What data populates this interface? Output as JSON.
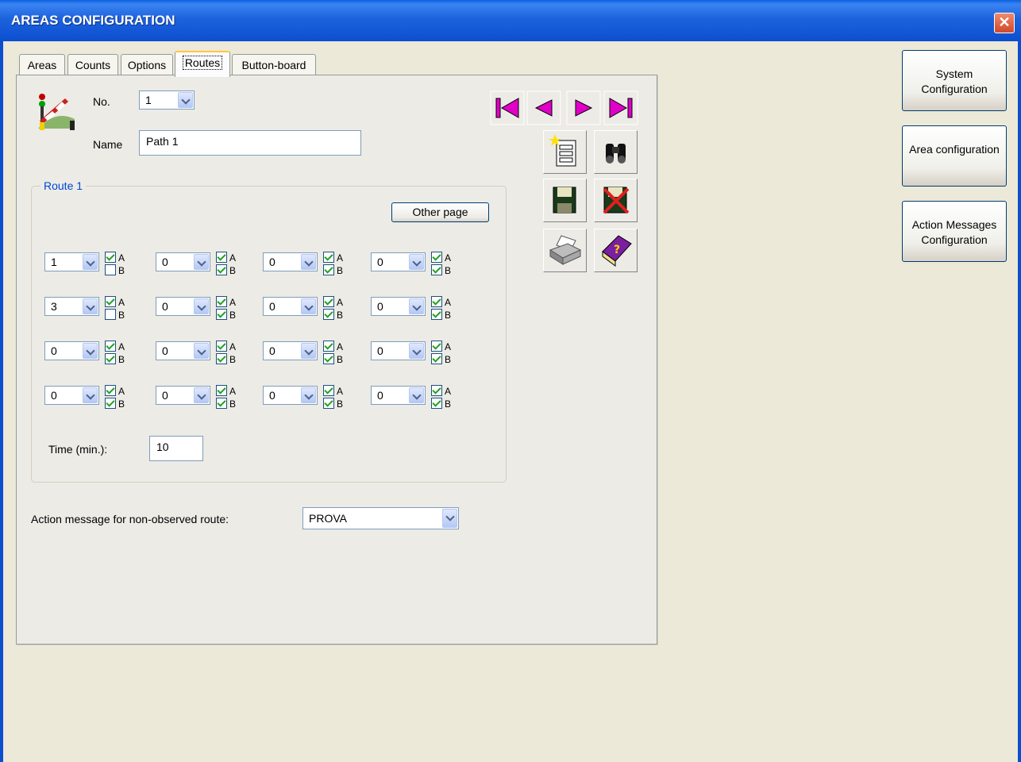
{
  "window": {
    "title": "AREAS CONFIGURATION",
    "close_glyph": "✕"
  },
  "tabs": [
    {
      "label": "Areas"
    },
    {
      "label": "Counts"
    },
    {
      "label": "Options"
    },
    {
      "label": "Routes",
      "active": true
    },
    {
      "label": "Button-board"
    }
  ],
  "header": {
    "no_label": "No.",
    "no_value": "1",
    "name_label": "Name",
    "name_value": "Path 1"
  },
  "route": {
    "title": "Route 1",
    "other_page_label": "Other page",
    "rows": [
      [
        {
          "v": "1",
          "a": true,
          "b": false
        },
        {
          "v": "0",
          "a": true,
          "b": true
        },
        {
          "v": "0",
          "a": true,
          "b": true
        },
        {
          "v": "0",
          "a": true,
          "b": true
        }
      ],
      [
        {
          "v": "3",
          "a": true,
          "b": false
        },
        {
          "v": "0",
          "a": true,
          "b": true
        },
        {
          "v": "0",
          "a": true,
          "b": true
        },
        {
          "v": "0",
          "a": true,
          "b": true
        }
      ],
      [
        {
          "v": "0",
          "a": true,
          "b": true
        },
        {
          "v": "0",
          "a": true,
          "b": true
        },
        {
          "v": "0",
          "a": true,
          "b": true
        },
        {
          "v": "0",
          "a": true,
          "b": true
        }
      ],
      [
        {
          "v": "0",
          "a": true,
          "b": true
        },
        {
          "v": "0",
          "a": true,
          "b": true
        },
        {
          "v": "0",
          "a": true,
          "b": true
        },
        {
          "v": "0",
          "a": true,
          "b": true
        }
      ]
    ],
    "cb_a_label": "A",
    "cb_b_label": "B",
    "time_label": "Time (min.):",
    "time_value": "10"
  },
  "action": {
    "label": "Action message for non-observed route:",
    "value": "PROVA"
  },
  "toolbar": {
    "icons": [
      "first-record-icon",
      "previous-record-icon",
      "next-record-icon",
      "last-record-icon",
      "new-record-icon",
      "find-icon",
      "save-icon",
      "delete-icon",
      "print-icon",
      "help-icon"
    ],
    "accent_magenta": "#e000c8",
    "accent_purple": "#7a1fa0"
  },
  "side": {
    "system_config": "System Configuration",
    "area_config": "Area configuration",
    "action_messages_config": "Action Messages Configuration"
  }
}
